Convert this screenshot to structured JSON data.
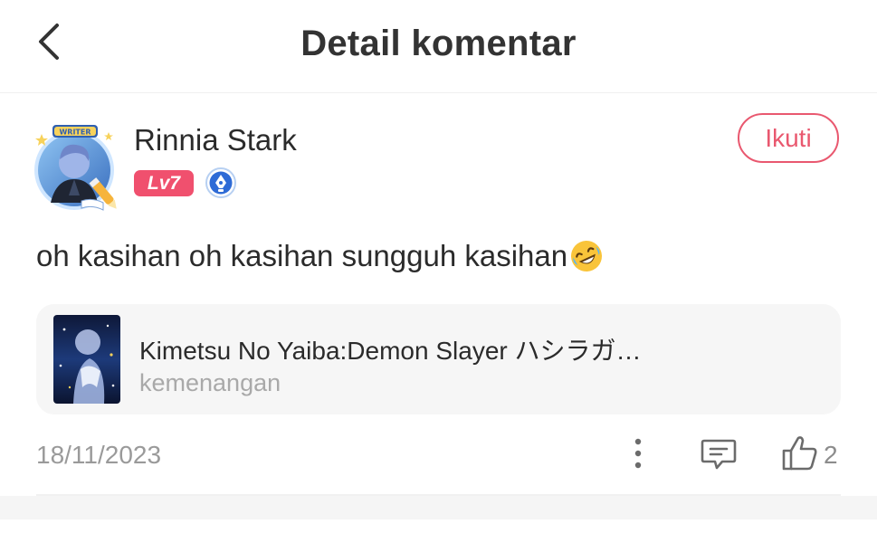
{
  "header": {
    "title": "Detail komentar",
    "back_icon": "chevron-left-icon"
  },
  "author": {
    "name": "Rinnia Stark",
    "level": "Lv7",
    "avatar_frame_label": "WRITER",
    "writer_badge_icon": "pen-nib-icon",
    "follow_label": "Ikuti"
  },
  "comment": {
    "text": "oh kasihan oh kasihan sungguh kasihan",
    "emoji_icon": "rolling-on-floor-laughing-icon"
  },
  "book": {
    "title": "Kimetsu No Yaiba:Demon Slayer ハシラガ…",
    "subtitle": "kemenangan"
  },
  "footer": {
    "date": "18/11/2023",
    "like_count": "2"
  },
  "colors": {
    "accent": "#e9586f",
    "level_badge": "#f0506e",
    "card_bg": "#f6f6f6",
    "muted_text": "#9a9a9a"
  }
}
